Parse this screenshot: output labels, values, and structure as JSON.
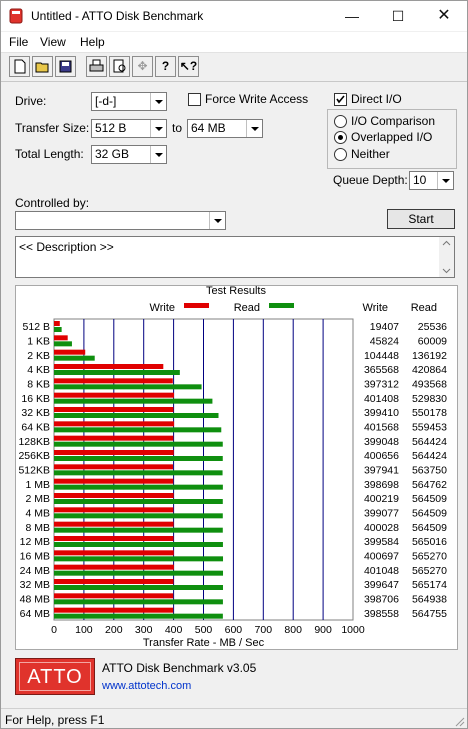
{
  "window": {
    "title": "Untitled - ATTO Disk Benchmark"
  },
  "menu": [
    "File",
    "View",
    "Help"
  ],
  "toolbar": {
    "icons": [
      "new-icon",
      "open-icon",
      "save-icon",
      "print-icon",
      "print-preview-icon",
      "move-icon",
      "help-icon",
      "context-help-icon"
    ]
  },
  "form": {
    "drive_label": "Drive:",
    "drive_value": "[-d-]",
    "transfer_size_label": "Transfer Size:",
    "transfer_from": "512 B",
    "to_label": "to",
    "transfer_to": "64 MB",
    "total_length_label": "Total Length:",
    "total_length": "32 GB",
    "force_write_access": "Force Write Access",
    "direct_io": "Direct I/O",
    "io_comparison": "I/O Comparison",
    "overlapped_io": "Overlapped I/O",
    "neither": "Neither",
    "queue_depth_label": "Queue Depth:",
    "queue_depth": "10",
    "controlled_by_label": "Controlled by:",
    "controlled_by_value": "",
    "start_button": "Start",
    "description": "<< Description >>"
  },
  "results": {
    "title": "Test Results",
    "write_legend": "Write",
    "read_legend": "Read",
    "write_header": "Write",
    "read_header": "Read"
  },
  "chart_data": {
    "type": "bar",
    "orientation": "horizontal",
    "xlabel": "Transfer Rate - MB / Sec",
    "xlim": [
      0,
      1000
    ],
    "xticks": [
      "0",
      "100",
      "200",
      "300",
      "400",
      "500",
      "600",
      "700",
      "800",
      "900",
      "1000"
    ],
    "grid": true,
    "legend_position": "top",
    "colors": {
      "write": "#e00000",
      "read": "#0f8f0f",
      "grid": "#000080"
    },
    "categories": [
      "512 B",
      "1 KB",
      "2 KB",
      "4 KB",
      "8 KB",
      "16 KB",
      "32 KB",
      "64 KB",
      "128KB",
      "256KB",
      "512KB",
      "1 MB",
      "2 MB",
      "4 MB",
      "8 MB",
      "12 MB",
      "16 MB",
      "24 MB",
      "32 MB",
      "48 MB",
      "64 MB"
    ],
    "series": [
      {
        "name": "Write",
        "values": [
          19407,
          45824,
          104448,
          365568,
          397312,
          401408,
          399410,
          401568,
          399048,
          400656,
          397941,
          398698,
          400219,
          399077,
          400028,
          399584,
          400697,
          401048,
          399647,
          398706,
          398558
        ]
      },
      {
        "name": "Read",
        "values": [
          25536,
          60009,
          136192,
          420864,
          493568,
          529830,
          550178,
          559453,
          564424,
          564424,
          563750,
          564762,
          564509,
          564509,
          564509,
          565016,
          565270,
          565270,
          565174,
          564938,
          564755
        ]
      }
    ]
  },
  "footer": {
    "logo": "ATTO",
    "product": "ATTO Disk Benchmark v3.05",
    "url": "www.attotech.com",
    "logo_color": "#e0332c"
  },
  "status": {
    "text": "For Help, press F1"
  }
}
